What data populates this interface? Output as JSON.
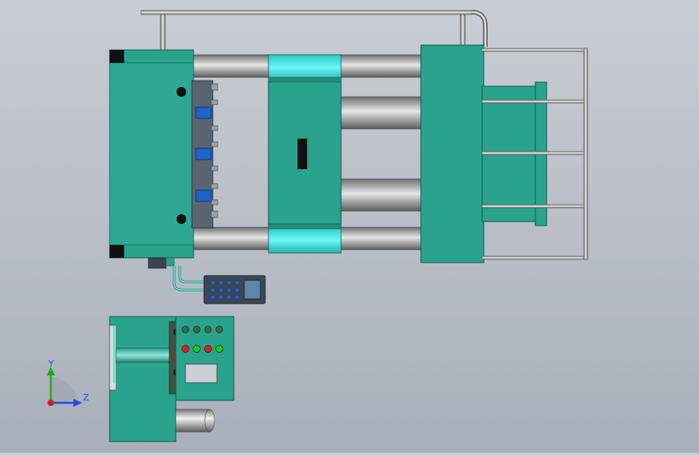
{
  "view": {
    "background_top": "#c9cdd4",
    "background_bottom": "#a9afba"
  },
  "palette": {
    "machine_green": "#2aa38c",
    "machine_green_dark": "#1d7e6c",
    "cyan_band": "#3fe0e0",
    "rod_silver": "#9a9a9a",
    "panel_blue": "#1f63c8",
    "button_red": "#e01e1e",
    "button_green": "#1ec81e"
  },
  "triad": {
    "y_label": "Y",
    "z_label": "Z",
    "y_axis_color": "#22aa22",
    "z_axis_color": "#1f4fd8",
    "origin_color": "#d42020"
  }
}
